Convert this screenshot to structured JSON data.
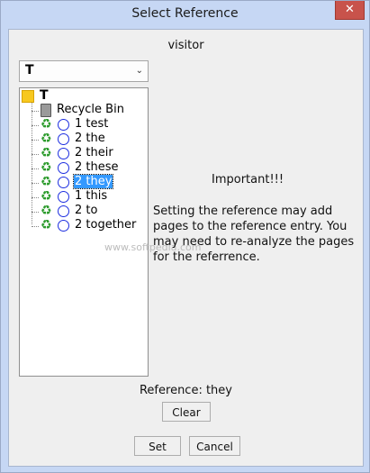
{
  "window": {
    "title": "Select Reference",
    "close_symbol": "✕"
  },
  "dialog": {
    "heading": "visitor",
    "dropdown": {
      "selected": "T",
      "arrow": "⌄"
    },
    "tree": {
      "root": {
        "label": "T",
        "icon": "folder-icon"
      },
      "recycle_bin": {
        "label": "Recycle Bin",
        "icon": "recycle-bin-icon"
      },
      "items": [
        {
          "label": "1 test",
          "selected": false
        },
        {
          "label": "2 the",
          "selected": false
        },
        {
          "label": "2 their",
          "selected": false
        },
        {
          "label": "2 these",
          "selected": false
        },
        {
          "label": "2 they",
          "selected": true
        },
        {
          "label": "1 this",
          "selected": false
        },
        {
          "label": "2 to",
          "selected": false
        },
        {
          "label": "2 together",
          "selected": false
        }
      ]
    },
    "important": "Important!!!",
    "info": "Setting the reference may add pages to the reference entry.  You may need to re-analyze the pages for the referrence.",
    "reference_label": "Reference: they",
    "watermark": "www.softpedia.com",
    "buttons": {
      "clear": "Clear",
      "set": "Set",
      "cancel": "Cancel"
    }
  },
  "colors": {
    "title_bg": "#c6d7f4",
    "selection": "#3399ff",
    "close_button": "#c8534b"
  }
}
